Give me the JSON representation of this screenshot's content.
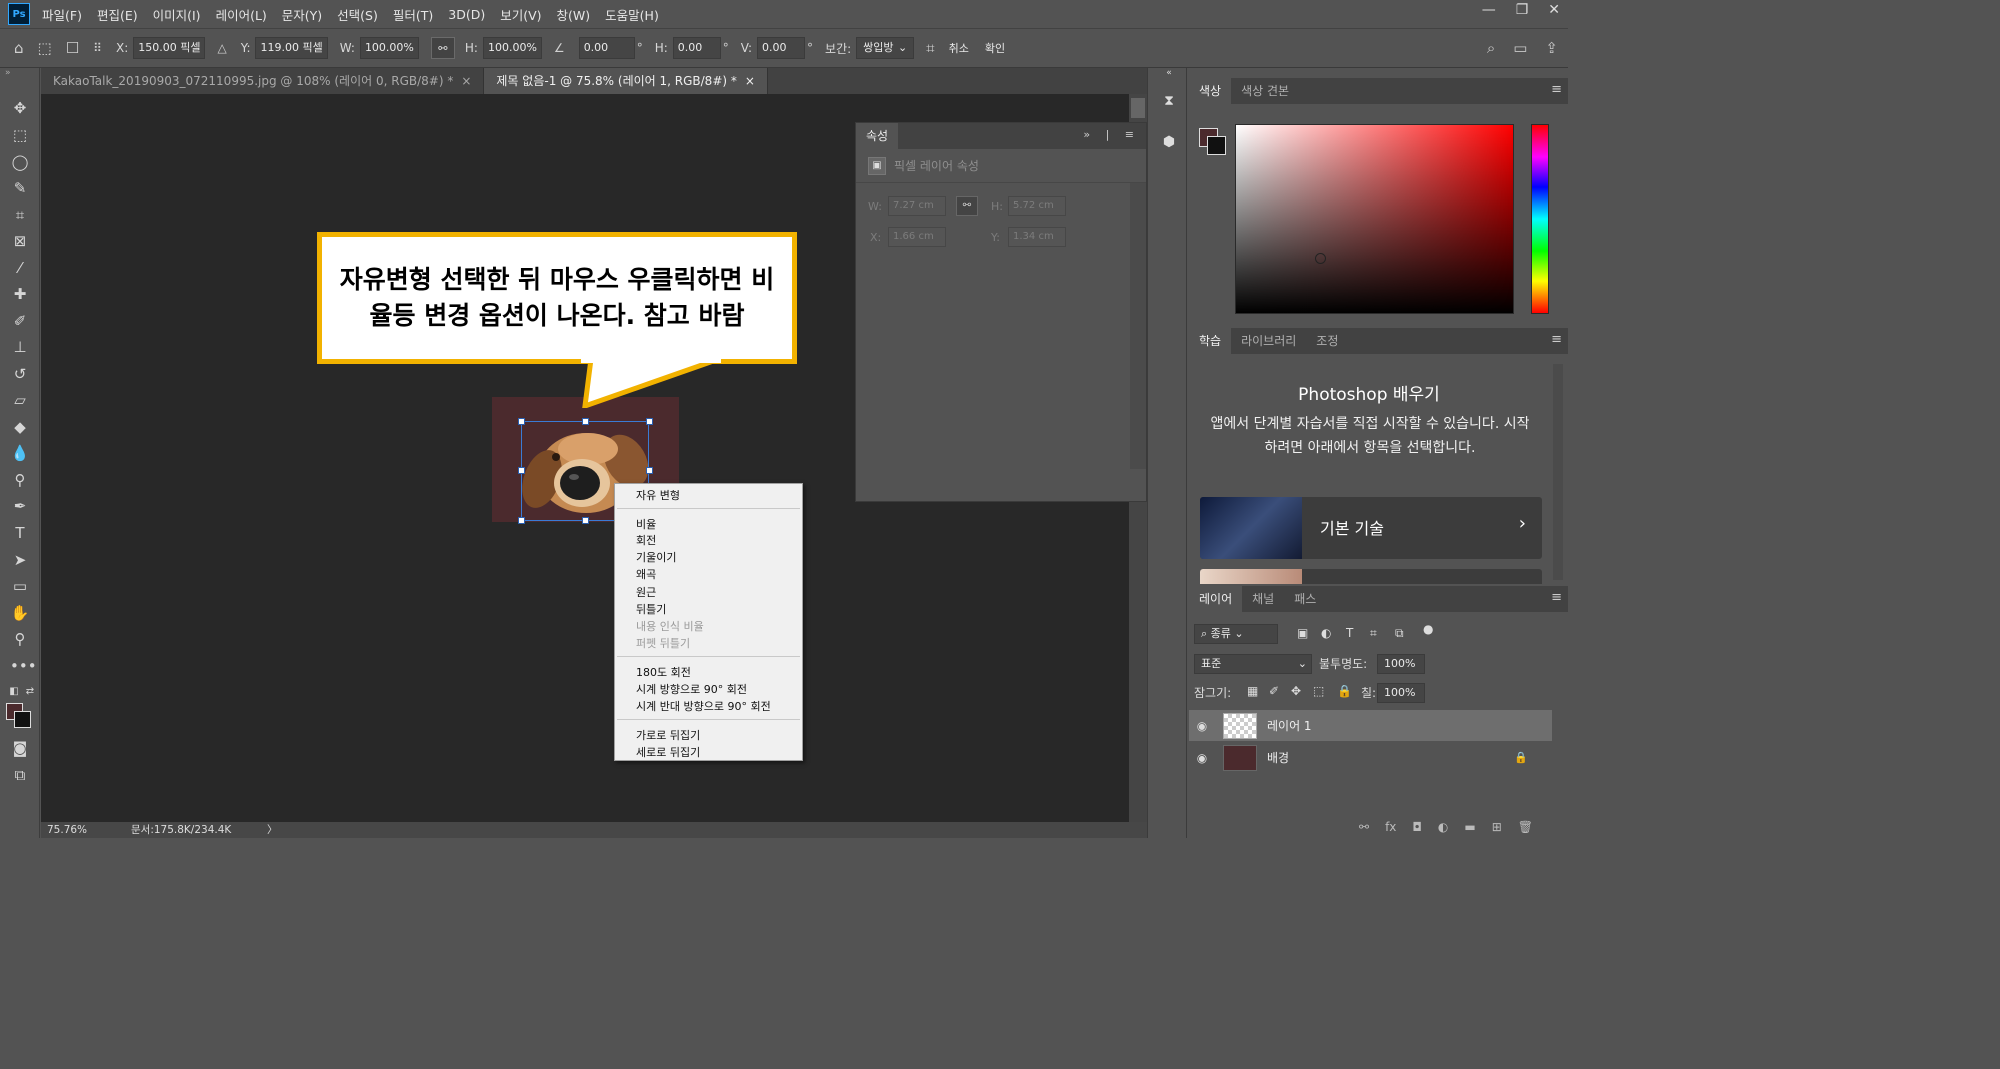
{
  "app": {
    "logo": "Ps"
  },
  "menu": [
    "파일(F)",
    "편집(E)",
    "이미지(I)",
    "레이어(L)",
    "문자(Y)",
    "선택(S)",
    "필터(T)",
    "3D(D)",
    "보기(V)",
    "창(W)",
    "도움말(H)"
  ],
  "window_controls": {
    "min": "—",
    "restore": "❐",
    "close": "✕"
  },
  "options": {
    "x_label": "X:",
    "x_value": "150.00 픽셀",
    "y_label": "Y:",
    "y_value": "119.00 픽셀",
    "w_label": "W:",
    "w_value": "100.00%",
    "h_label": "H:",
    "h_value": "100.00%",
    "rot_value": "0.00",
    "hskew_label": "H:",
    "hskew_value": "0.00",
    "vskew_label": "V:",
    "vskew_value": "0.00",
    "degree": "°",
    "interp_label": "보간:",
    "interp_value": "쌍입방",
    "cancel": "취소",
    "commit": "확인"
  },
  "tabs": [
    {
      "label": "KakaoTalk_20190903_072110995.jpg  @  108% (레이어 0, RGB/8#) *",
      "close": "×"
    },
    {
      "label": "제목 없음-1 @ 75.8% (레이어 1, RGB/8#) *",
      "close": "×"
    }
  ],
  "callout": {
    "line1": "자유변형 선택한 뒤 마우스 우클릭하면 비",
    "line2": "율등 변경 옵션이 나온다. 참고 바람"
  },
  "context_menu": {
    "free_transform": "자유 변형",
    "scale": "비율",
    "rotate": "회전",
    "skew": "기울이기",
    "distort": "왜곡",
    "perspective": "원근",
    "warp": "뒤틀기",
    "content_aware_scale": "내용 인식 비율",
    "puppet_warp": "퍼펫 뒤틀기",
    "rotate_180": "180도 회전",
    "rotate_cw": "시계 방향으로 90° 회전",
    "rotate_ccw": "시계 반대 방향으로 90° 회전",
    "flip_h": "가로로 뒤집기",
    "flip_v": "세로로 뒤집기"
  },
  "properties": {
    "tab": "속성",
    "subtitle": "픽셀 레이어 속성",
    "w_label": "W:",
    "w_value": "7.27 cm",
    "h_label": "H:",
    "h_value": "5.72 cm",
    "x_label": "X:",
    "x_value": "1.66 cm",
    "y_label": "Y:",
    "y_value": "1.34 cm"
  },
  "color_panel": {
    "tab_color": "색상",
    "tab_swatches": "색상 견본",
    "fg_color": "#4b2a2d",
    "bg_color": "#111111"
  },
  "learn_panel": {
    "tab_learn": "학습",
    "tab_library": "라이브러리",
    "tab_adjust": "조정",
    "title": "Photoshop 배우기",
    "desc": "앱에서 단계별 자습서를 직접 시작할 수 있습니다. 시작하려면 아래에서 항목을 선택합니다.",
    "card": "기본 기술"
  },
  "layers_panel": {
    "tab_layers": "레이어",
    "tab_channels": "채널",
    "tab_paths": "패스",
    "filter_kind": "종류",
    "blend_mode": "표준",
    "opacity_label": "불투명도:",
    "opacity_value": "100%",
    "lock_label": "잠그기:",
    "fill_label": "칠:",
    "fill_value": "100%",
    "layers": [
      {
        "name": "레이어 1"
      },
      {
        "name": "배경"
      }
    ]
  },
  "status": {
    "zoom": "75.76%",
    "doc": "문서:175.8K/234.4K"
  }
}
